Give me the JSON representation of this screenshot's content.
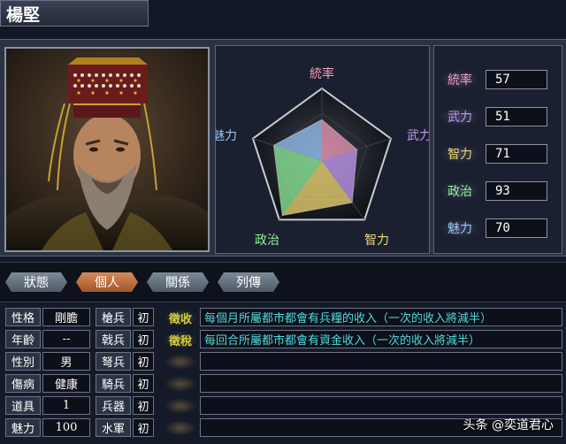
{
  "character_name": "楊堅",
  "radar": {
    "labels": {
      "leadership": "統率",
      "war": "武力",
      "intelligence": "智力",
      "politics": "政治",
      "charm": "魅力"
    },
    "values": [
      57,
      51,
      71,
      93,
      70
    ],
    "max": 100
  },
  "stats": [
    {
      "label": "統率",
      "value": "57",
      "color": "#f09ab8"
    },
    {
      "label": "武力",
      "value": "51",
      "color": "#c59af5"
    },
    {
      "label": "智力",
      "value": "71",
      "color": "#f0d870"
    },
    {
      "label": "政治",
      "value": "93",
      "color": "#8ff09a"
    },
    {
      "label": "魅力",
      "value": "70",
      "color": "#9ac5f5"
    }
  ],
  "tabs": [
    {
      "label": "狀態",
      "active": false
    },
    {
      "label": "個人",
      "active": true
    },
    {
      "label": "關係",
      "active": false
    },
    {
      "label": "列傳",
      "active": false
    }
  ],
  "attributes": [
    {
      "label": "性格",
      "value": "剛膽",
      "troop": "槍兵",
      "rank": "初"
    },
    {
      "label": "年齡",
      "value": "--",
      "troop": "戟兵",
      "rank": "初"
    },
    {
      "label": "性別",
      "value": "男",
      "troop": "弩兵",
      "rank": "初"
    },
    {
      "label": "傷病",
      "value": "健康",
      "troop": "騎兵",
      "rank": "初"
    },
    {
      "label": "道具",
      "value": "1",
      "troop": "兵器",
      "rank": "初"
    },
    {
      "label": "魅力",
      "value": "100",
      "troop": "水軍",
      "rank": "初"
    }
  ],
  "skills": [
    {
      "name": "徵收",
      "desc": "每個月所屬都市都會有兵糧的收入（一次的收入將減半）",
      "color": "#d8c83a"
    },
    {
      "name": "徵稅",
      "desc": "每回合所屬都市都會有資金收入（一次的收入將減半）",
      "color": "#d8c83a"
    },
    {
      "name": "",
      "desc": "",
      "color": "#6a5a4a"
    },
    {
      "name": "",
      "desc": "",
      "color": "#6a5a4a"
    },
    {
      "name": "",
      "desc": "",
      "color": "#6a5a4a"
    },
    {
      "name": "",
      "desc": "",
      "color": "#6a5a4a"
    }
  ],
  "watermark": "头条 @奕道君心"
}
